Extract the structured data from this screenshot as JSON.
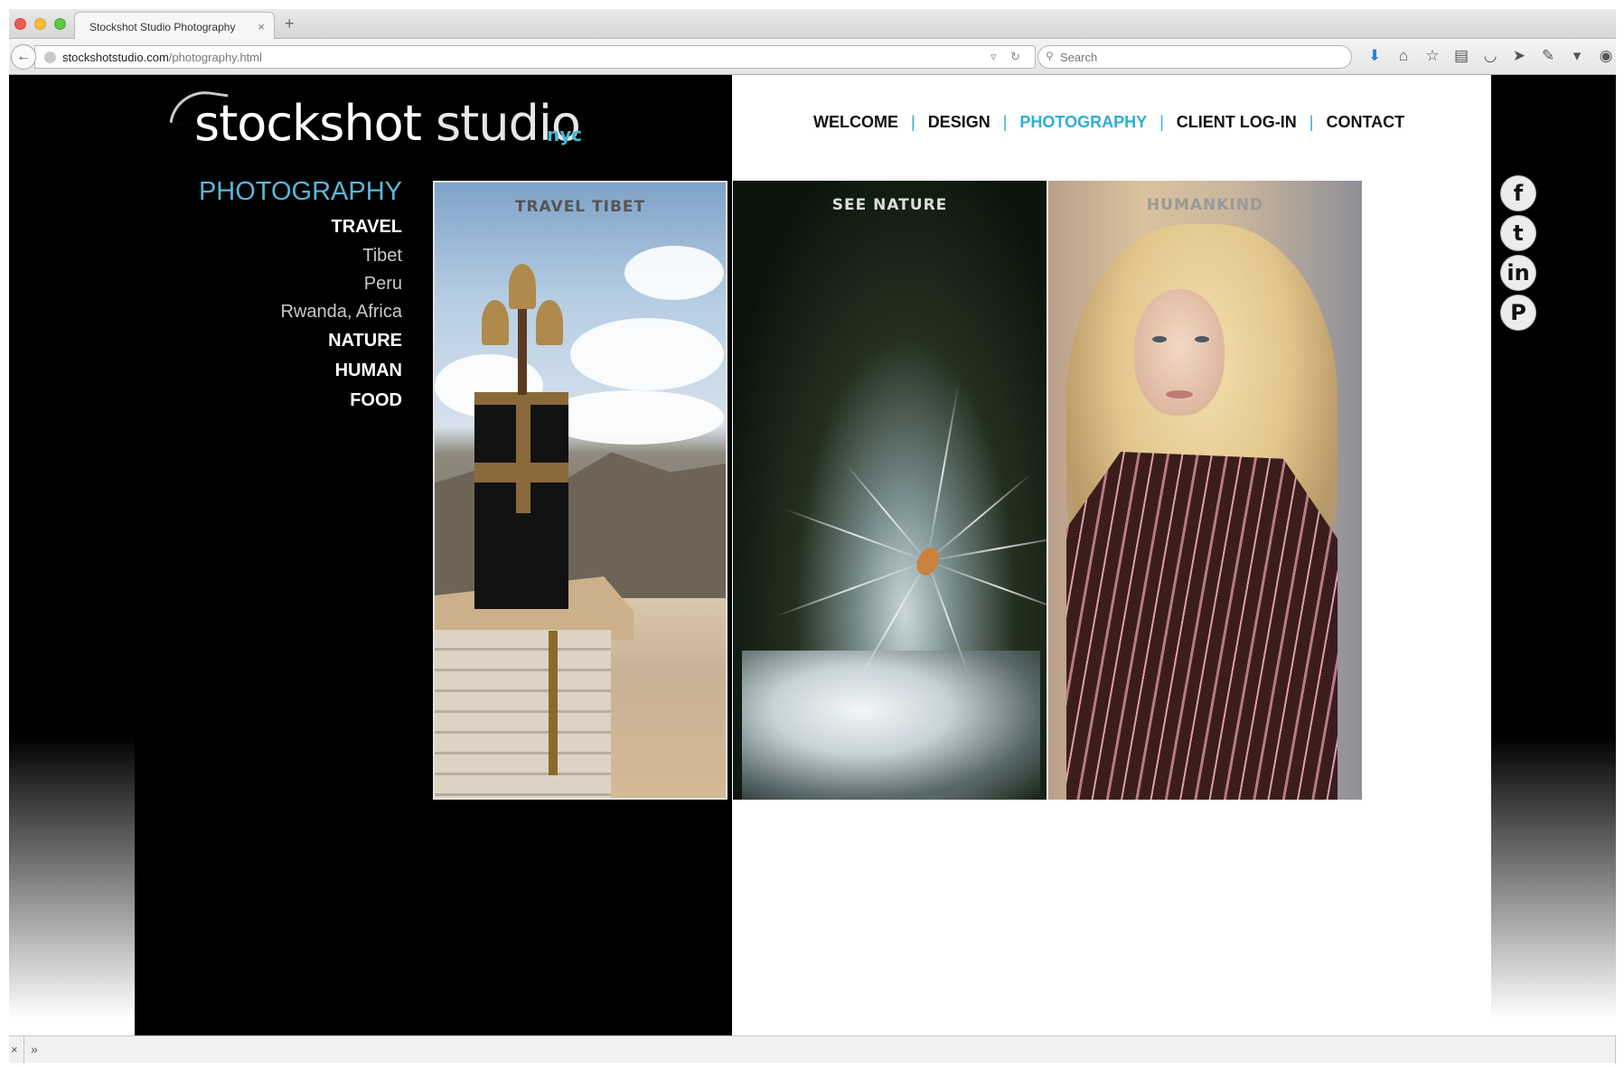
{
  "browser": {
    "tab_title": "Stockshot Studio Photography",
    "tab_close": "×",
    "new_tab": "+",
    "url_domain": "stockshotstudio.com",
    "url_path": "/photography.html",
    "search_placeholder": "Search",
    "url_tools": "▿ ↻",
    "toolbar_icons": [
      "download-icon",
      "home-icon",
      "bookmark-star-icon",
      "reading-list-icon",
      "pocket-icon",
      "send-icon",
      "extension-icon",
      "menu-chevron-icon",
      "chat-icon"
    ],
    "status_close": "×",
    "status_more": "»"
  },
  "site": {
    "logo_main": "stockshot",
    "logo_studio": "studio",
    "logo_nyc": "nyc",
    "accent_color": "#2eaed6",
    "nav": [
      {
        "label": "WELCOME",
        "active": false
      },
      {
        "label": "DESIGN",
        "active": false
      },
      {
        "label": "PHOTOGRAPHY",
        "active": true
      },
      {
        "label": "CLIENT LOG-IN",
        "active": false
      },
      {
        "label": "CONTACT",
        "active": false
      }
    ],
    "sidebar": {
      "heading": "PHOTOGRAPHY",
      "travel": "TRAVEL",
      "tibet": "Tibet",
      "peru": "Peru",
      "rwanda": "Rwanda, Africa",
      "nature": "NATURE",
      "human": "HUMAN",
      "food": "FOOD"
    },
    "gallery": {
      "tibet": "TRAVEL TIBET",
      "nature": "SEE NATURE",
      "human": "HUMANKIND"
    },
    "social": {
      "facebook": "f",
      "twitter": "t",
      "linkedin": "in",
      "pinterest": "P"
    }
  }
}
